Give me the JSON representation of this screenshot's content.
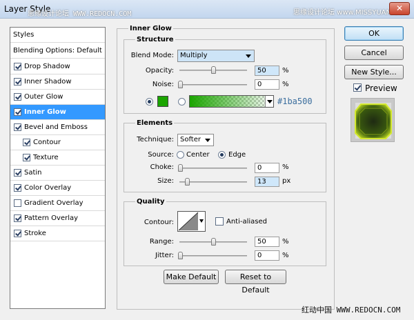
{
  "window": {
    "title": "Layer Style",
    "watermark_left": "思缘设计论坛 WWW.REDOCN.COM",
    "watermark_right": "思缘设计论坛 www.MISSYUAN.COM",
    "close_label": "✕"
  },
  "style_list": {
    "header_styles": "Styles",
    "header_blending": "Blending Options: Default",
    "items": [
      {
        "label": "Drop Shadow",
        "checked": true,
        "sub": false,
        "selected": false
      },
      {
        "label": "Inner Shadow",
        "checked": true,
        "sub": false,
        "selected": false
      },
      {
        "label": "Outer Glow",
        "checked": true,
        "sub": false,
        "selected": false
      },
      {
        "label": "Inner Glow",
        "checked": true,
        "sub": false,
        "selected": true
      },
      {
        "label": "Bevel and Emboss",
        "checked": true,
        "sub": false,
        "selected": false
      },
      {
        "label": "Contour",
        "checked": true,
        "sub": true,
        "selected": false
      },
      {
        "label": "Texture",
        "checked": true,
        "sub": true,
        "selected": false
      },
      {
        "label": "Satin",
        "checked": true,
        "sub": false,
        "selected": false
      },
      {
        "label": "Color Overlay",
        "checked": true,
        "sub": false,
        "selected": false
      },
      {
        "label": "Gradient Overlay",
        "checked": false,
        "sub": false,
        "selected": false
      },
      {
        "label": "Pattern Overlay",
        "checked": true,
        "sub": false,
        "selected": false
      },
      {
        "label": "Stroke",
        "checked": true,
        "sub": false,
        "selected": false
      }
    ]
  },
  "inner_glow": {
    "title": "Inner Glow",
    "structure": {
      "title": "Structure",
      "blend_mode_label": "Blend Mode:",
      "blend_mode_value": "Multiply",
      "opacity_label": "Opacity:",
      "opacity_value": "50",
      "opacity_unit": "%",
      "noise_label": "Noise:",
      "noise_value": "0",
      "noise_unit": "%",
      "color_hex": "#1ba500",
      "color_label": "#1ba500"
    },
    "elements": {
      "title": "Elements",
      "technique_label": "Technique:",
      "technique_value": "Softer",
      "source_label": "Source:",
      "source_center": "Center",
      "source_edge": "Edge",
      "choke_label": "Choke:",
      "choke_value": "0",
      "choke_unit": "%",
      "size_label": "Size:",
      "size_value": "13",
      "size_unit": "px"
    },
    "quality": {
      "title": "Quality",
      "contour_label": "Contour:",
      "anti_aliased_label": "Anti-aliased",
      "range_label": "Range:",
      "range_value": "50",
      "range_unit": "%",
      "jitter_label": "Jitter:",
      "jitter_value": "0",
      "jitter_unit": "%"
    },
    "make_default": "Make Default",
    "reset_default": "Reset to Default"
  },
  "side": {
    "ok": "OK",
    "cancel": "Cancel",
    "new_style": "New Style...",
    "preview_label": "Preview"
  },
  "footer_watermark": "红动中国 WWW.REDOCN.COM"
}
